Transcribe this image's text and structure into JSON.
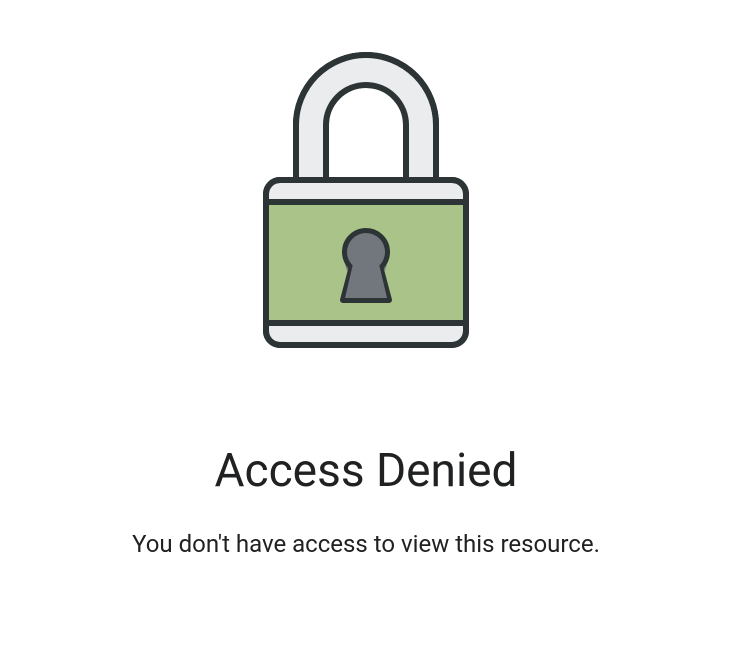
{
  "heading": "Access Denied",
  "message": "You don't have access to view this resource."
}
